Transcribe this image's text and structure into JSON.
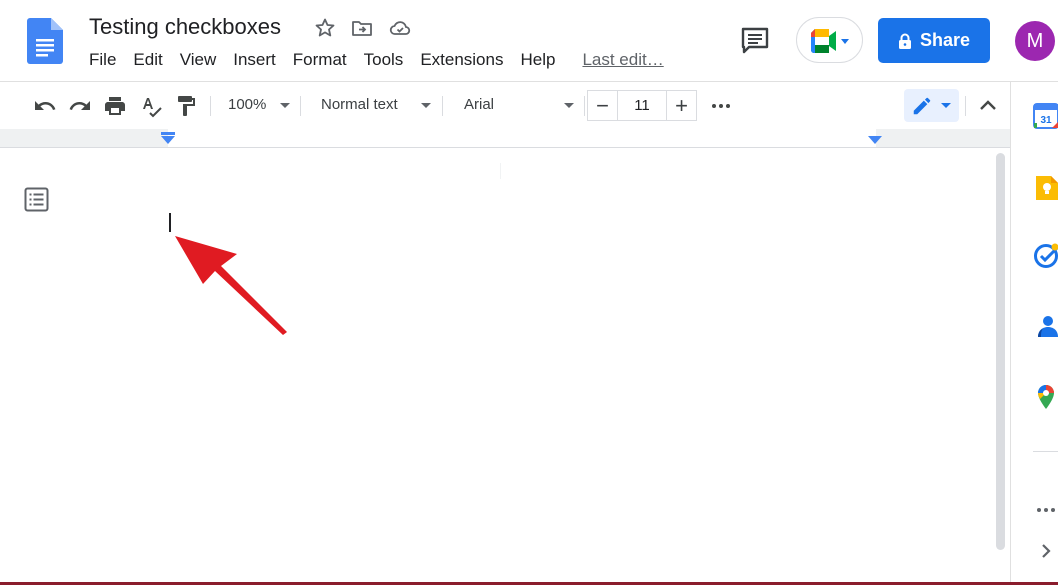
{
  "document": {
    "title": "Testing checkboxes"
  },
  "menu": [
    "File",
    "Edit",
    "View",
    "Insert",
    "Format",
    "Tools",
    "Extensions",
    "Help"
  ],
  "last_edit": "Last edit…",
  "share_label": "Share",
  "avatar_initial": "M",
  "toolbar": {
    "zoom": "100%",
    "style": "Normal text",
    "font": "Arial",
    "font_size": "11",
    "minus": "−",
    "plus": "+"
  },
  "icons": {
    "title": [
      "star-icon",
      "move-to-folder-icon",
      "cloud-saved-icon"
    ],
    "toolbar": [
      "undo-icon",
      "redo-icon",
      "print-icon",
      "spellcheck-icon",
      "paint-format-icon",
      "more-options-icon",
      "edit-mode-pencil-icon",
      "collapse-menus-icon"
    ],
    "side_panel": [
      "calendar-icon",
      "keep-icon",
      "tasks-icon",
      "contacts-icon",
      "maps-icon",
      "more-icon",
      "expand-icon"
    ]
  },
  "calendar_day": "31",
  "colors": {
    "accent": "#1a73e8",
    "avatar": "#9c27b0",
    "annotation_arrow": "#e01b22"
  }
}
